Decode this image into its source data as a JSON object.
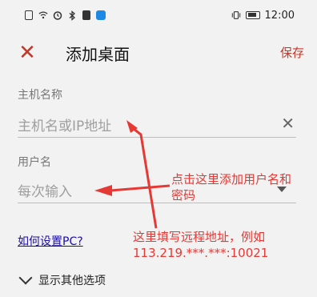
{
  "status_bar": {
    "time": "12:00",
    "left_icons": [
      "sim-icon",
      "wifi-icon",
      "alarm-icon",
      "bluetooth-icon",
      "notification-icon",
      "chat-icon"
    ],
    "right_icons": [
      "vibrate-icon",
      "battery-icon"
    ]
  },
  "toolbar": {
    "close_glyph": "✕",
    "title": "添加桌面",
    "save_label": "保存"
  },
  "host_field": {
    "label": "主机名称",
    "placeholder": "主机名或IP地址",
    "clear_glyph": "✕"
  },
  "user_field": {
    "label": "用户名",
    "placeholder": "每次输入"
  },
  "help_link": "如何设置PC?",
  "more_options": "显示其他选项",
  "annotations": {
    "user_note_line1": "点击这里添加用户名和",
    "user_note_line2": "密码",
    "host_note_line1": "这里填写远程地址，例如",
    "host_note_line2": "113.219.***.***:10021"
  },
  "colors": {
    "accent": "#c0392b",
    "annotation": "#e53935",
    "background": "#f2f2f2",
    "link": "#1a0dab"
  }
}
